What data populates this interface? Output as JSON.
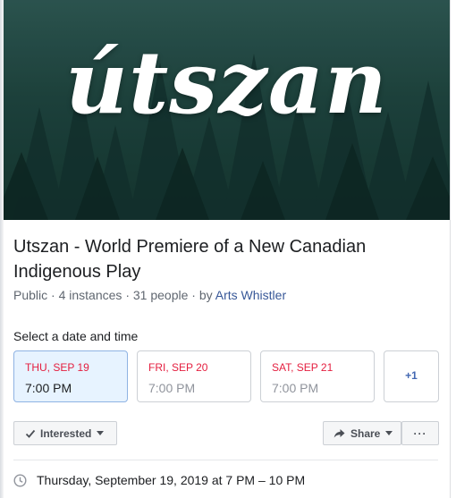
{
  "banner": {
    "title": "útszan"
  },
  "event": {
    "title": "Utszan - World Premiere of a New Canadian Indigenous Play",
    "visibility": "Public",
    "instances": "4 instances",
    "people": "31 people",
    "by_prefix": "by",
    "host": "Arts Whistler",
    "separator": "·"
  },
  "dates": {
    "label": "Select a date and time",
    "options": [
      {
        "day": "THU, SEP 19",
        "time": "7:00 PM",
        "selected": true
      },
      {
        "day": "FRI, SEP 20",
        "time": "7:00 PM",
        "selected": false
      },
      {
        "day": "SAT, SEP 21",
        "time": "7:00 PM",
        "selected": false
      }
    ],
    "more": "+1"
  },
  "actions": {
    "interested": "Interested",
    "share": "Share",
    "more": "···"
  },
  "details": {
    "datetime": "Thursday, September 19, 2019 at 7 PM – 10 PM"
  },
  "colors": {
    "accent": "#4267b2",
    "date_red": "#e41e3f",
    "link": "#385898",
    "selected_bg": "#e7f3ff"
  },
  "icons": {
    "interested": "check-icon",
    "share": "share-arrow-icon",
    "datetime": "clock-icon"
  }
}
